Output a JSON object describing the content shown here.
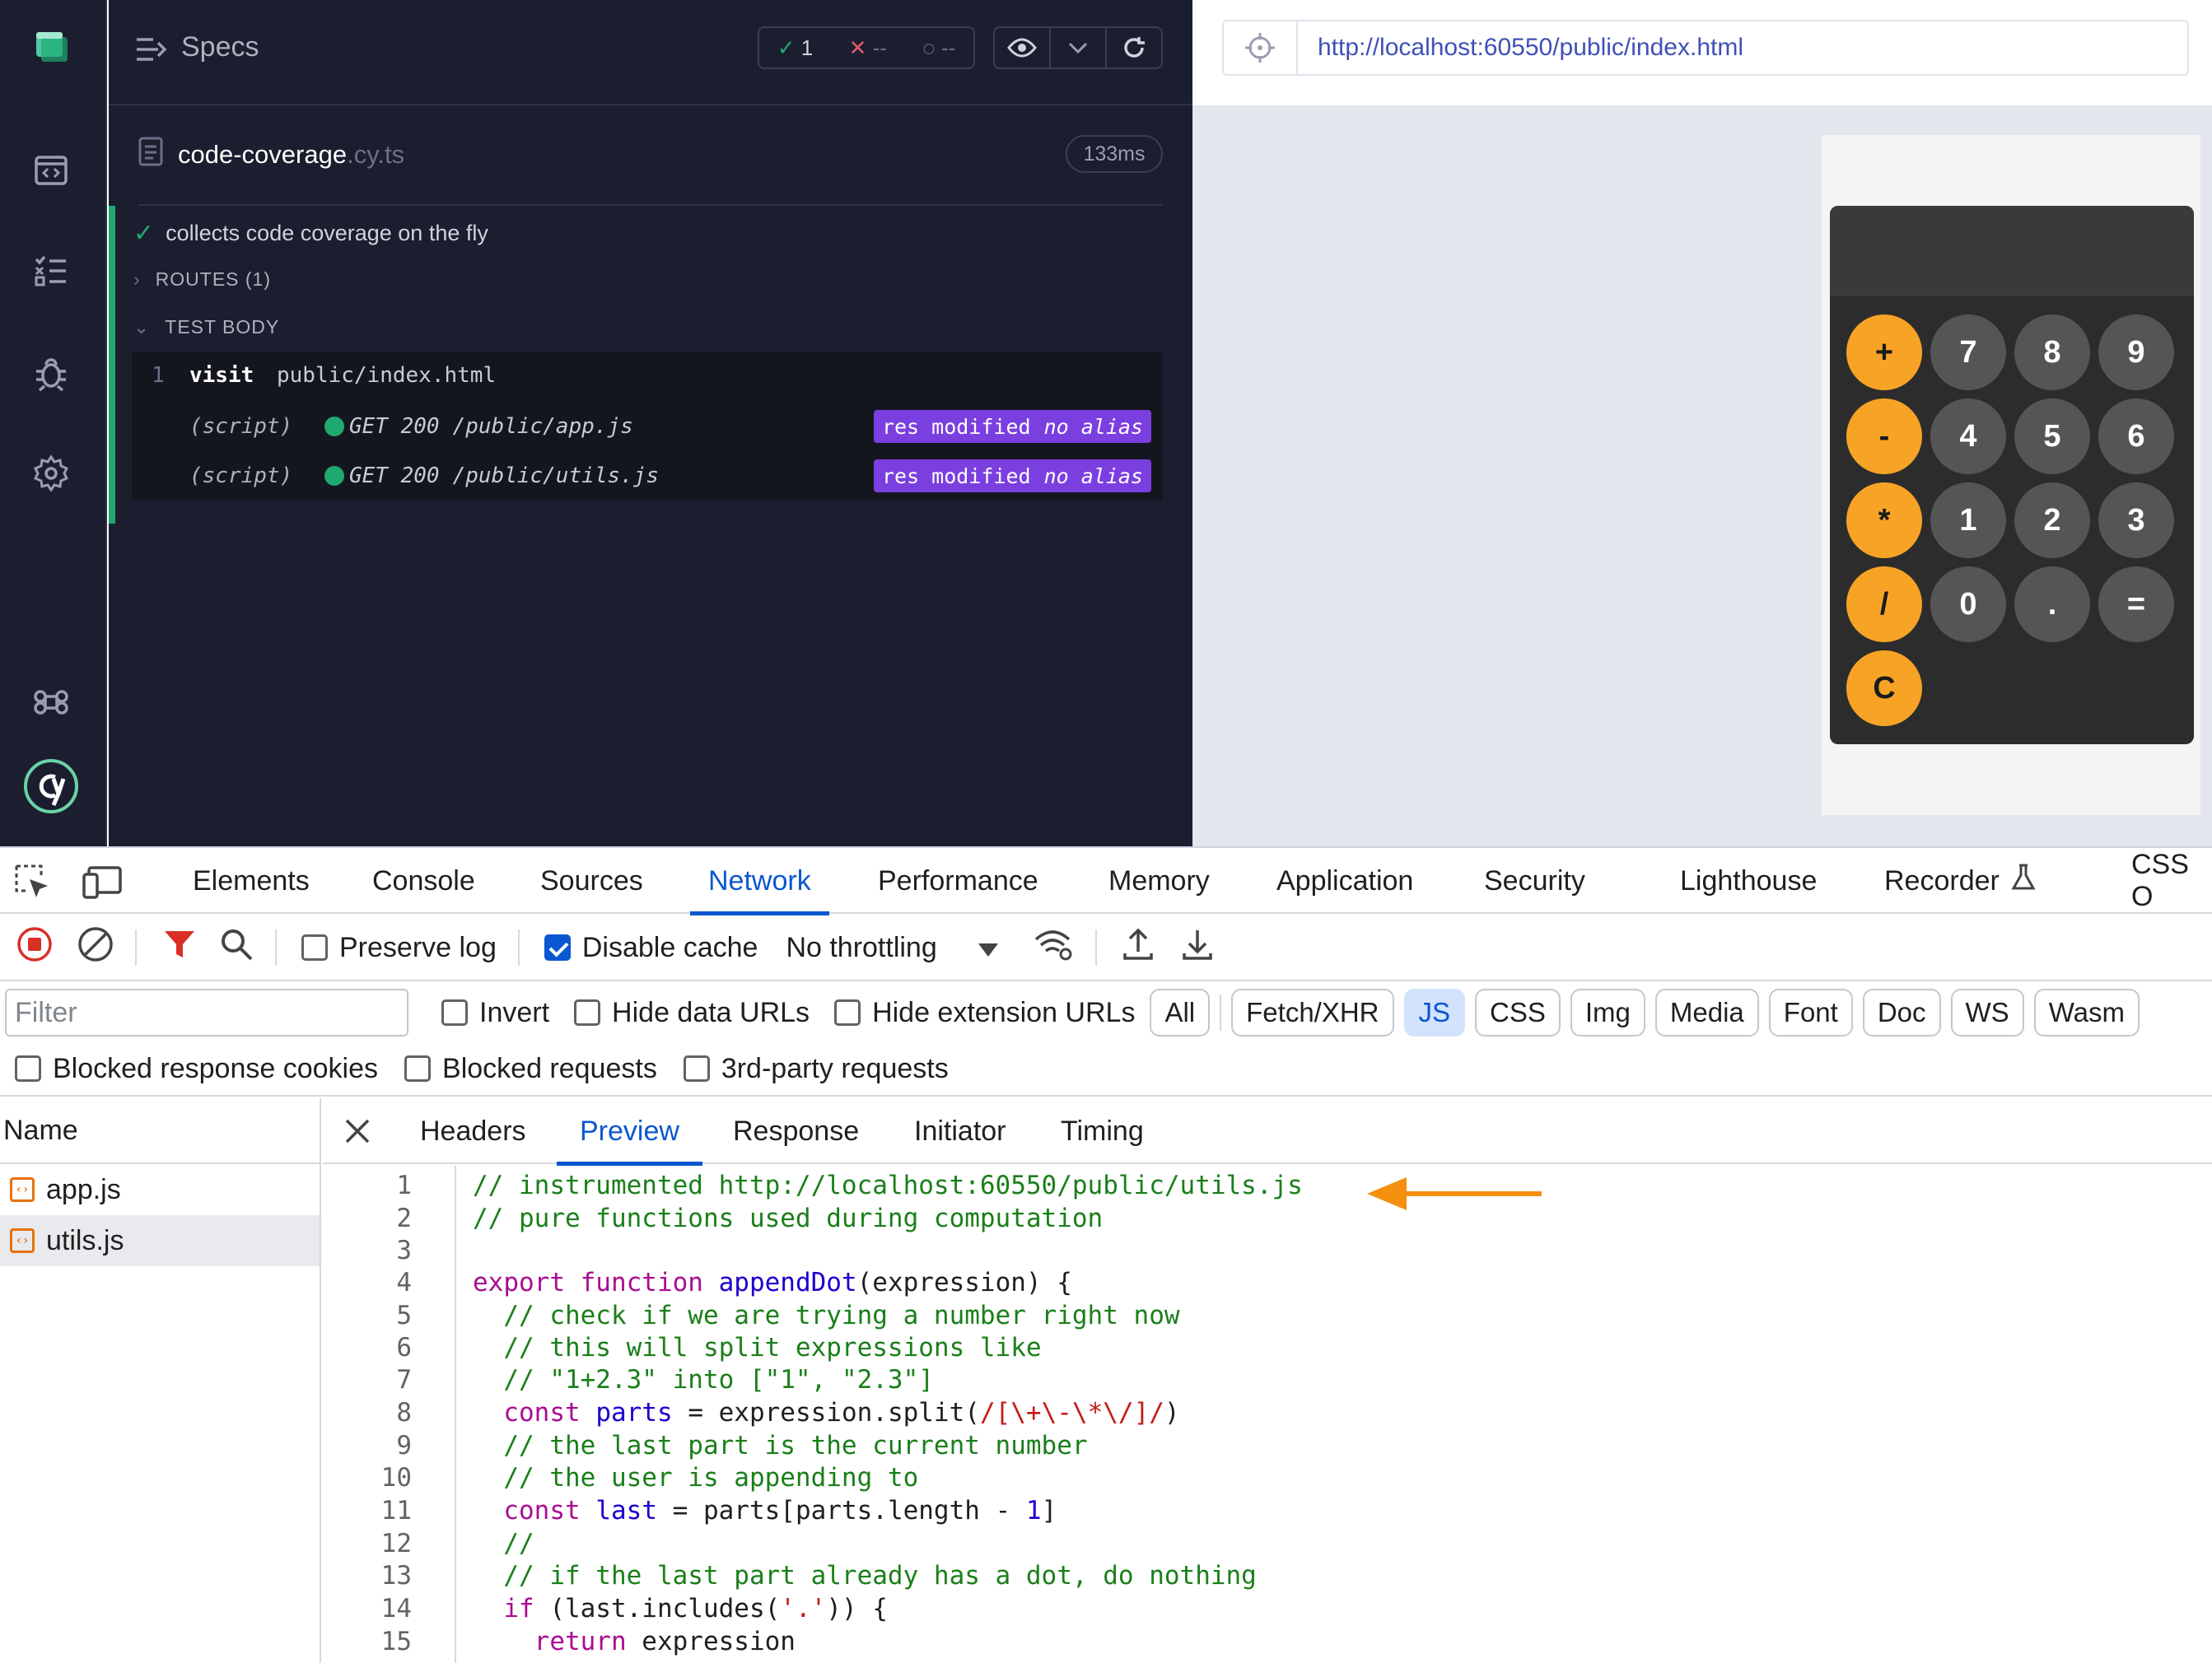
{
  "runner": {
    "header_title": "Specs",
    "stats": {
      "passed": "1",
      "failed": "--",
      "pending": "--"
    },
    "spec_file": {
      "name": "code-coverage",
      "ext": ".cy.ts",
      "duration": "133ms"
    },
    "test_title": "collects code coverage on the fly",
    "routes_label": "ROUTES (1)",
    "test_body_label": "TEST BODY",
    "commands": [
      {
        "num": "1",
        "name": "visit",
        "message": "public/index.html"
      },
      {
        "num": "",
        "name": "(script)",
        "method": "GET 200",
        "path": "/public/app.js",
        "badge_a": "res modified",
        "badge_b": "no alias"
      },
      {
        "num": "",
        "name": "(script)",
        "method": "GET 200",
        "path": "/public/utils.js",
        "badge_a": "res modified",
        "badge_b": "no alias"
      }
    ]
  },
  "aut": {
    "url": "http://localhost:60550/public/index.html",
    "calculator_keys": [
      "+",
      "7",
      "8",
      "9",
      "-",
      "4",
      "5",
      "6",
      "*",
      "1",
      "2",
      "3",
      "/",
      "0",
      ".",
      "=",
      "C"
    ],
    "colors": {
      "operator": "#f7a325",
      "digit": "#555555",
      "body": "#2c2c2c"
    }
  },
  "devtools": {
    "tabs": [
      "Elements",
      "Console",
      "Sources",
      "Network",
      "Performance",
      "Memory",
      "Application",
      "Security",
      "Lighthouse",
      "Recorder",
      "CSS O"
    ],
    "active_tab": "Network",
    "toolbar": {
      "preserve_log": "Preserve log",
      "disable_cache": "Disable cache",
      "throttling": "No throttling"
    },
    "filter": {
      "placeholder": "Filter",
      "invert": "Invert",
      "hide_data_urls": "Hide data URLs",
      "hide_extension_urls": "Hide extension URLs",
      "chips": [
        "All",
        "Fetch/XHR",
        "JS",
        "CSS",
        "Img",
        "Media",
        "Font",
        "Doc",
        "WS",
        "Wasm"
      ],
      "active_chip": "JS",
      "blocked_cookies": "Blocked response cookies",
      "blocked_requests": "Blocked requests",
      "third_party": "3rd-party requests"
    },
    "name_header": "Name",
    "files": [
      "app.js",
      "utils.js"
    ],
    "selected_file": "utils.js",
    "detail_tabs": [
      "Headers",
      "Preview",
      "Response",
      "Initiator",
      "Timing"
    ],
    "active_detail_tab": "Preview",
    "code_lines": [
      "1",
      "2",
      "3",
      "4",
      "5",
      "6",
      "7",
      "8",
      "9",
      "10",
      "11",
      "12",
      "13",
      "14",
      "15"
    ],
    "code": {
      "l1": "// instrumented http://localhost:60550/public/utils.js",
      "l2": "// pure functions used during computation",
      "l4_kw": "export function",
      "l4_fn": "appendDot",
      "l4_arg": "(expression) {",
      "l5": "  // check if we are trying a number right now",
      "l6": "  // this will split expressions like",
      "l7": "  // \"1+2.3\" into [\"1\", \"2.3\"]",
      "l8_kw": "  const",
      "l8_var": "parts",
      "l8_mid": " = expression.split(",
      "l8_re": "/[\\+\\-\\*\\/]/",
      "l8_end": ")",
      "l9": "  // the last part is the current number",
      "l10": "  // the user is appending to",
      "l11_kw": "  const",
      "l11_var": "last",
      "l11_mid": " = parts[parts.length - ",
      "l11_num": "1",
      "l11_end": "]",
      "l12": "  //",
      "l13": "  // if the last part already has a dot, do nothing",
      "l14_kw": "  if",
      "l14_mid": " (last.includes(",
      "l14_str": "'.'",
      "l14_end": ")) {",
      "l15_kw": "    return",
      "l15_mid": " expression"
    },
    "arrow_color": "#f5900f"
  }
}
